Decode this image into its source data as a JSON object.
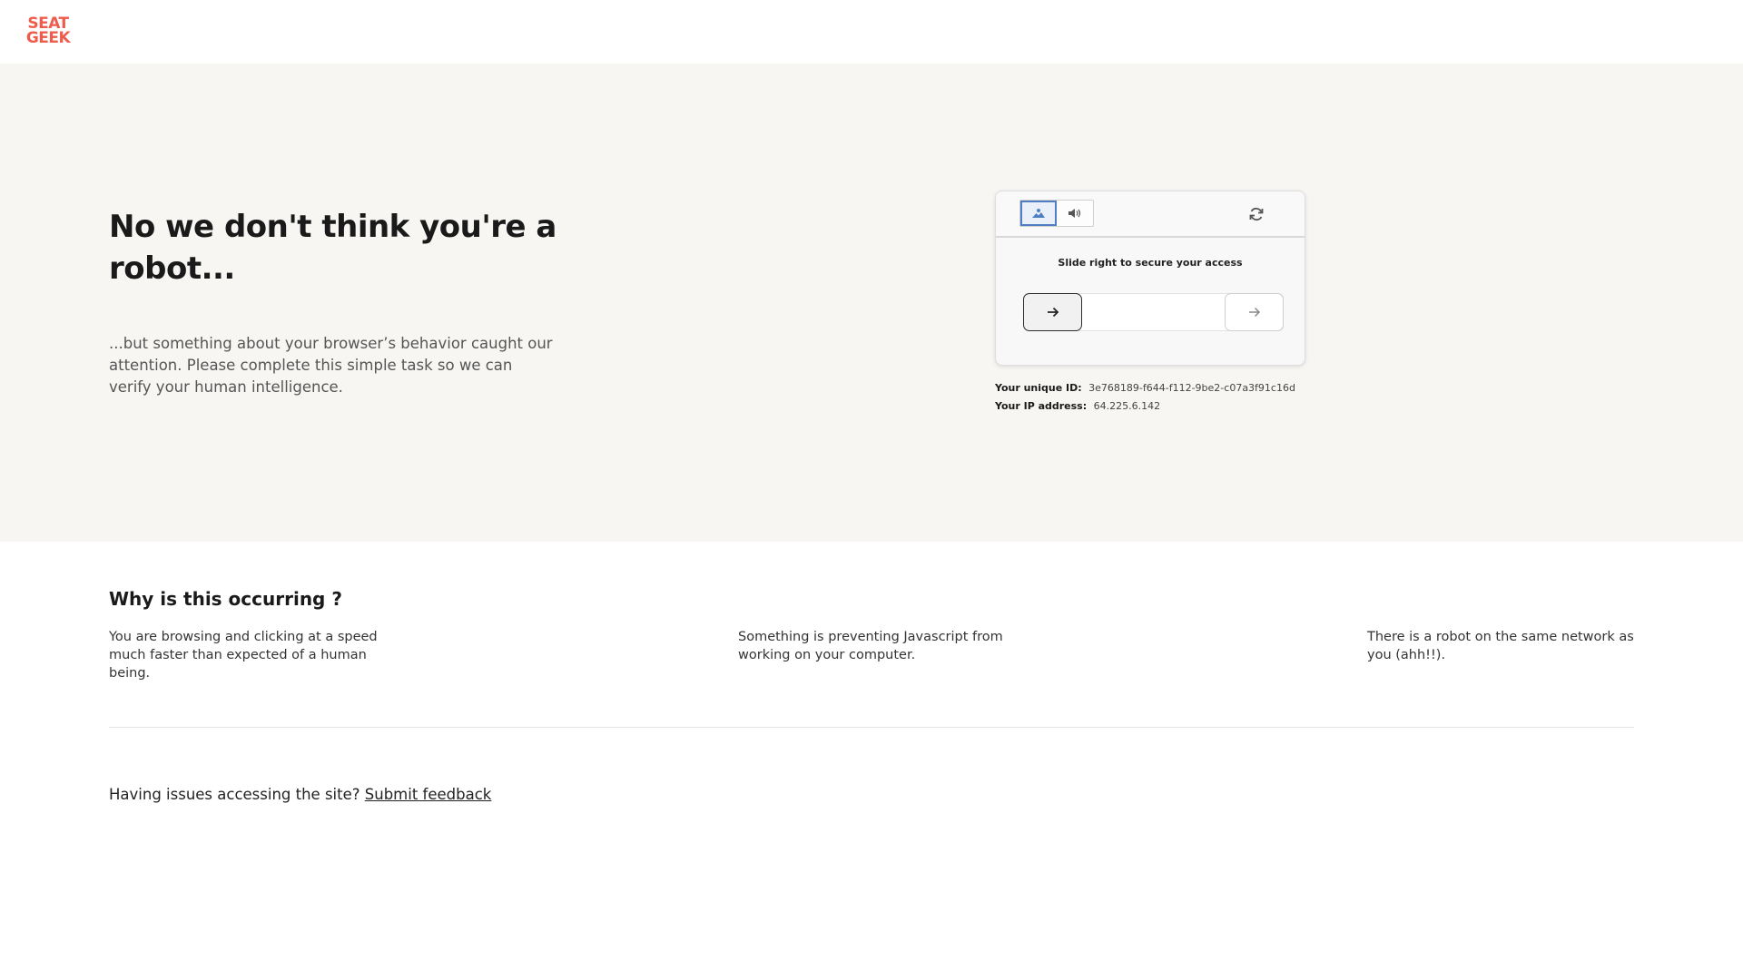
{
  "header": {
    "logo_line1": "SEAT",
    "logo_line2": "GEEK",
    "brand_color": "#ee5c4c"
  },
  "hero": {
    "title": "No we don't think you're a robot...",
    "description": "...but something about your browser’s behavior caught our attention. Please complete this simple task so we can verify your human intelligence."
  },
  "captcha": {
    "modes": [
      {
        "icon": "image-icon",
        "active": true
      },
      {
        "icon": "audio-icon",
        "active": false
      }
    ],
    "refresh_icon": "refresh-icon",
    "instruction": "Slide right to secure your access",
    "handle_icon": "arrow-right-icon",
    "target_icon": "arrow-right-icon",
    "accent_color": "#4f7fc2"
  },
  "meta": {
    "unique_id_label": "Your unique ID:",
    "unique_id_value": "3e768189-f644-f112-9be2-c07a3f91c16d",
    "ip_label": "Your IP address:",
    "ip_value": "64.225.6.142"
  },
  "why": {
    "title": "Why is this occurring ?",
    "reasons": [
      "You are browsing and clicking at a speed much faster than expected of a human being.",
      "Something is preventing Javascript from working on your computer.",
      "There is a robot on the same network as you (ahh!!)."
    ]
  },
  "feedback": {
    "question": "Having issues accessing the site?",
    "link_label": "Submit feedback"
  }
}
